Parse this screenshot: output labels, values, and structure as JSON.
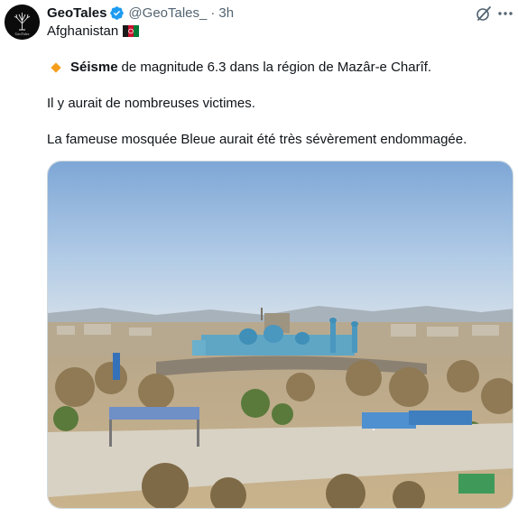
{
  "tweet": {
    "display_name": "GeoTales",
    "handle": "@GeoTales_",
    "separator": "·",
    "time": "3h",
    "subtitle": "Afghanistan",
    "line1_bold": "Séisme",
    "line1_rest": "de magnitude 6.3 dans la région de Mazâr-e Charîf.",
    "line2": "Il y aurait de nombreuses victimes.",
    "line3": "La fameuse mosquée Bleue aurait été très sévèrement endommagée.",
    "avatar_text": "GeoTales"
  },
  "icons": {
    "verified": "verified-badge-icon",
    "grok": "grok-icon",
    "more": "more-icon",
    "flag": "afghanistan-flag-icon",
    "bullet": "orange-diamond-icon"
  },
  "colors": {
    "verified_blue": "#1d9bf0",
    "secondary_text": "#536471",
    "bullet_orange": "#f59e1b"
  }
}
